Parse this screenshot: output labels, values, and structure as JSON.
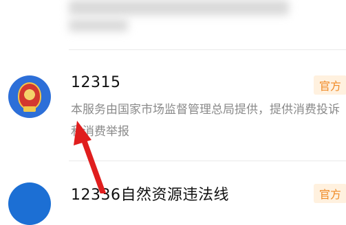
{
  "results": [
    {
      "title": "12315",
      "badge": "官方",
      "description": "本服务由国家市场监督管理总局提供，提供消费投诉和消费举报"
    },
    {
      "title": "12336自然资源违法线",
      "badge": "官方"
    }
  ],
  "colors": {
    "badge_bg": "#fff1df",
    "badge_text": "#f08a26",
    "avatar_blue": "#2d6fd8",
    "arrow_red": "#e01e1e"
  }
}
